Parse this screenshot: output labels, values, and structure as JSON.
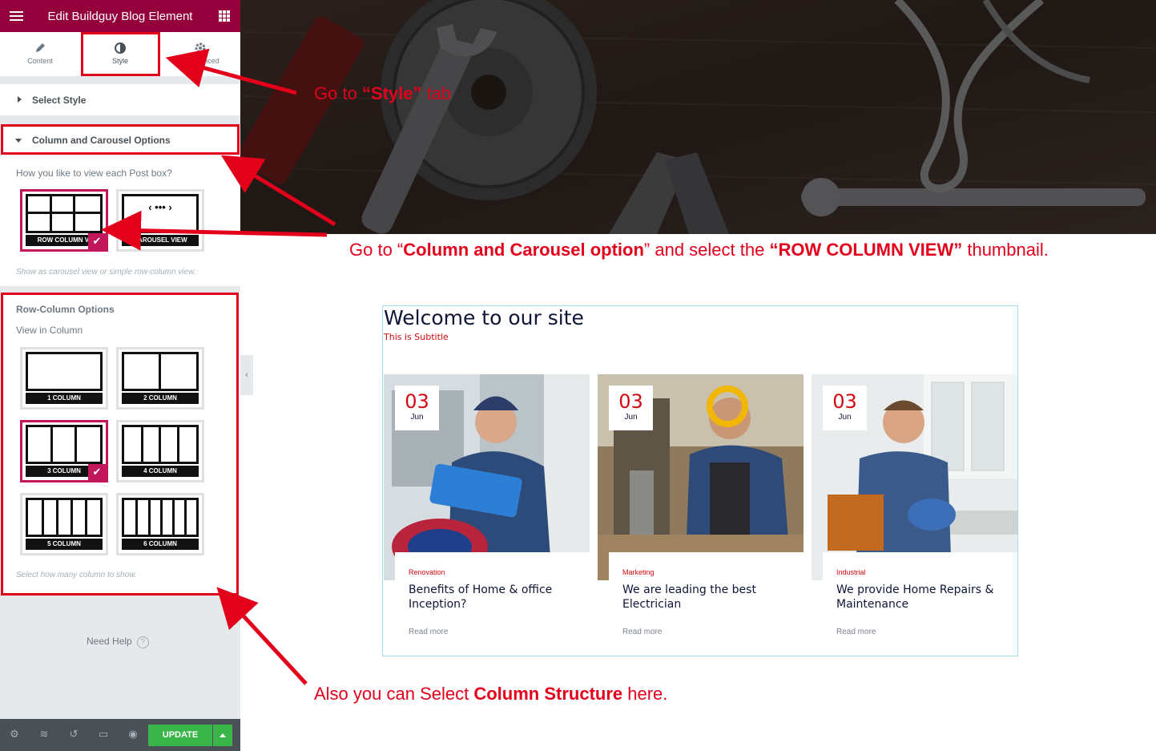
{
  "editor": {
    "title": "Edit Buildguy Blog Element",
    "menu_icon": "hamburger-icon",
    "apps_icon": "grid-icon",
    "tabs": [
      {
        "label": "Content",
        "icon": "pencil-icon"
      },
      {
        "label": "Style",
        "icon": "contrast-icon"
      },
      {
        "label": "nced",
        "icon": "gear-icon"
      }
    ],
    "sections": {
      "select_style": "Select Style",
      "column_carousel": "Column and Carousel Options"
    },
    "view_question": "How you like to view each Post box?",
    "view_options": [
      {
        "label": "ROW COLUMN VI",
        "selected": true
      },
      {
        "label": "CAROUSEL VIEW",
        "selected": false
      }
    ],
    "view_hint": "Show as carousel view or simple row-column view.",
    "row_column": {
      "heading": "Row-Column Options",
      "label": "View in Column",
      "options": [
        {
          "label": "1 COLUMN",
          "columns": 1,
          "selected": false
        },
        {
          "label": "2 COLUMN",
          "columns": 2,
          "selected": false
        },
        {
          "label": "3 COLUMN",
          "columns": 3,
          "selected": true
        },
        {
          "label": "4 COLUMN",
          "columns": 4,
          "selected": false
        },
        {
          "label": "5 COLUMN",
          "columns": 5,
          "selected": false
        },
        {
          "label": "6 COLUMN",
          "columns": 6,
          "selected": false
        }
      ],
      "hint": "Select how many column to show."
    },
    "need_help": "Need Help",
    "help_icon": "?",
    "footer": {
      "icons": [
        "gear-icon",
        "layers-icon",
        "history-icon",
        "responsive-icon",
        "eye-icon"
      ],
      "update_label": "UPDATE"
    },
    "collapse_glyph": "‹",
    "check_glyph": "✔",
    "accent": "#93003c",
    "update_color": "#39b54a"
  },
  "annotations": {
    "style_tab": {
      "pre": "Go  to ",
      "bold": "“Style”",
      "post": " tab"
    },
    "column_option": {
      "pre": "Go to “",
      "bold1": "Column and Carousel option",
      "mid": "” and select the ",
      "bold2": "“ROW COLUMN VIEW”",
      "post": " thumbnail."
    },
    "structure": {
      "pre": "Also you can Select ",
      "bold": "Column Structure",
      "post": " here."
    },
    "color": "#e3001b"
  },
  "preview": {
    "title": "Welcome to our site",
    "subtitle": "This is Subtitle",
    "posts": [
      {
        "day": "03",
        "month": "Jun",
        "category": "Renovation",
        "title": "Benefits of Home & office Inception?",
        "read_more": "Read more"
      },
      {
        "day": "03",
        "month": "Jun",
        "category": "Marketing",
        "title": "We are leading the best Electrician",
        "read_more": "Read more"
      },
      {
        "day": "03",
        "month": "Jun",
        "category": "Industrial",
        "title": "We provide Home Repairs & Maintenance",
        "read_more": "Read more"
      }
    ]
  }
}
